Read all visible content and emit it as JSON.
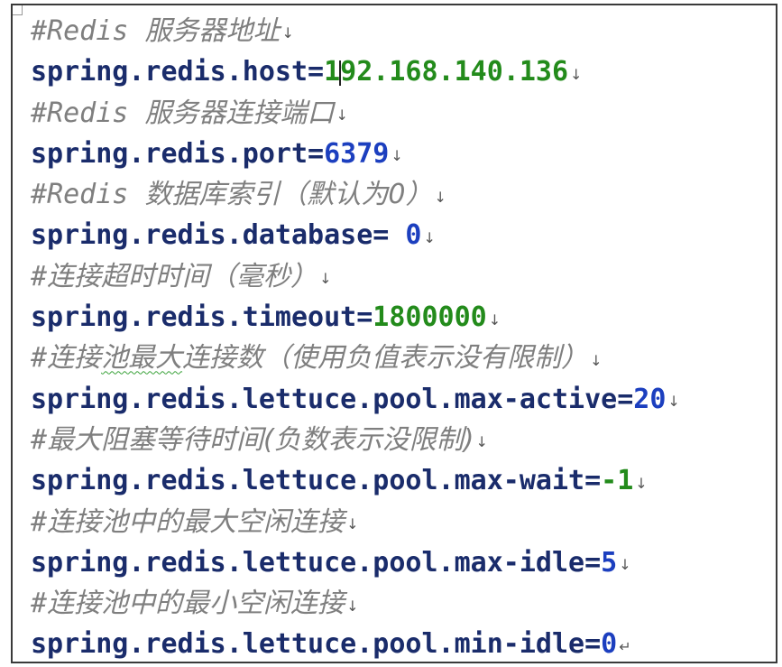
{
  "lines": [
    {
      "type": "comment",
      "prefix": "#Redis ",
      "text": "服务器地址",
      "mark": "↓"
    },
    {
      "type": "kv",
      "key": "spring.redis.host",
      "eq": "=",
      "value": "192.168.140.136",
      "value_color": "#238b1b",
      "mark": "↓"
    },
    {
      "type": "comment",
      "prefix": "#Redis ",
      "text": "服务器连接端口",
      "mark": "↓"
    },
    {
      "type": "kv",
      "key": "spring.redis.port",
      "eq": "=",
      "value": "6379",
      "value_color": "#1c3fbf",
      "mark": "↓"
    },
    {
      "type": "comment",
      "prefix": "#Redis ",
      "text": "数据库索引（默认为0）",
      "mark": "↓"
    },
    {
      "type": "kv",
      "key": "spring.redis.database",
      "eq": "= ",
      "value": "0",
      "value_color": "#1c3fbf",
      "mark": "↓"
    },
    {
      "type": "comment",
      "prefix": "#",
      "text": "连接超时时间（毫秒）",
      "mark": "↓"
    },
    {
      "type": "kv",
      "key": "spring.redis.timeout",
      "eq": "=",
      "value": "1800000",
      "value_color": "#238b1b",
      "mark": "↓"
    },
    {
      "type": "comment",
      "prefix": "#",
      "text": "连接池最大连接数（使用负值表示没有限制）",
      "mark": "↓"
    },
    {
      "type": "kv",
      "key": "spring.redis.lettuce.pool.max-active",
      "eq": "=",
      "value": "20",
      "value_color": "#1c3fbf",
      "mark": "↓"
    },
    {
      "type": "comment",
      "prefix": "#",
      "text": "最大阻塞等待时间(负数表示没限制)",
      "mark": "↓"
    },
    {
      "type": "kv",
      "key": "spring.redis.lettuce.pool.max-wait",
      "eq": "=",
      "value": "-1",
      "value_color": "#238b1b",
      "mark": "↓"
    },
    {
      "type": "comment",
      "prefix": "#",
      "text": "连接池中的最大空闲连接",
      "mark": "↓"
    },
    {
      "type": "kv",
      "key": "spring.redis.lettuce.pool.max-idle",
      "eq": "=",
      "value": "5",
      "value_color": "#1c3fbf",
      "mark": "↓"
    },
    {
      "type": "comment",
      "prefix": "#",
      "text": "连接池中的最小空闲连接",
      "mark": "↓"
    },
    {
      "type": "kv",
      "key": "spring.redis.lettuce.pool.min-idle",
      "eq": "=",
      "value": "0",
      "value_color": "#1c3fbf",
      "mark": "↵"
    }
  ],
  "spellcheck_squiggle_text": "池最大",
  "cursor": {
    "line": 1,
    "after_chars": 1
  }
}
